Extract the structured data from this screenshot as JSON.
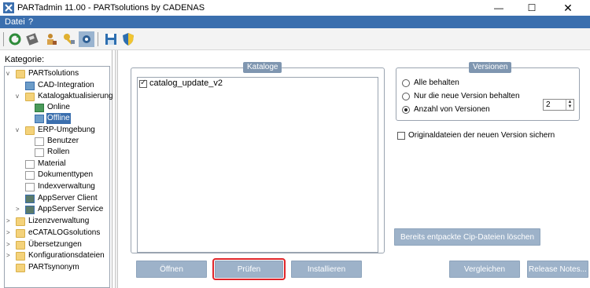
{
  "window": {
    "title": "PARTadmin 11.00 - PARTsolutions by CADENAS",
    "minimize": "—",
    "maximize": "☐",
    "close": "✕"
  },
  "menu": {
    "items": [
      "Datei",
      "?"
    ]
  },
  "toolbar": {
    "buttons": [
      "refresh-icon",
      "save-disk-icon",
      "user-icon",
      "key-icon",
      "settings-icon",
      "save-icon",
      "shield-icon"
    ]
  },
  "sidebar": {
    "label": "Kategorie:",
    "tree": [
      {
        "label": "PARTsolutions",
        "expander": "v"
      },
      {
        "label": "CAD-Integration",
        "expander": ""
      },
      {
        "label": "Katalogaktualisierung",
        "expander": "v"
      },
      {
        "label": "Online",
        "expander": ""
      },
      {
        "label": "Offline",
        "expander": "",
        "selected": true
      },
      {
        "label": "ERP-Umgebung",
        "expander": "v"
      },
      {
        "label": "Benutzer",
        "expander": ""
      },
      {
        "label": "Rollen",
        "expander": ""
      },
      {
        "label": "Material",
        "expander": ""
      },
      {
        "label": "Dokumenttypen",
        "expander": ""
      },
      {
        "label": "Indexverwaltung",
        "expander": ""
      },
      {
        "label": "AppServer Client",
        "expander": ""
      },
      {
        "label": "AppServer Service",
        "expander": ">"
      },
      {
        "label": "Lizenzverwaltung",
        "expander": ">"
      },
      {
        "label": "eCATALOGsolutions",
        "expander": ">"
      },
      {
        "label": "Übersetzungen",
        "expander": ">"
      },
      {
        "label": "Konfigurationsdateien",
        "expander": ">"
      },
      {
        "label": "PARTsynonym",
        "expander": ""
      }
    ]
  },
  "kataloge": {
    "title": "Kataloge",
    "items": [
      {
        "label": "catalog_update_v2",
        "checked": true
      }
    ]
  },
  "versionen": {
    "title": "Versionen",
    "options": [
      {
        "label": "Alle behalten",
        "checked": false
      },
      {
        "label": "Nur die neue Version behalten",
        "checked": false
      },
      {
        "label": "Anzahl von Versionen",
        "checked": true
      }
    ],
    "count": "2"
  },
  "original_checkbox": {
    "label": "Originaldateien der neuen Version sichern",
    "checked": false
  },
  "buttons": {
    "delete_cip": "Bereits entpackte Cip-Dateien löschen",
    "open": "Öffnen",
    "check": "Prüfen",
    "install": "Installieren",
    "compare": "Vergleichen",
    "release_notes": "Release Notes..."
  }
}
